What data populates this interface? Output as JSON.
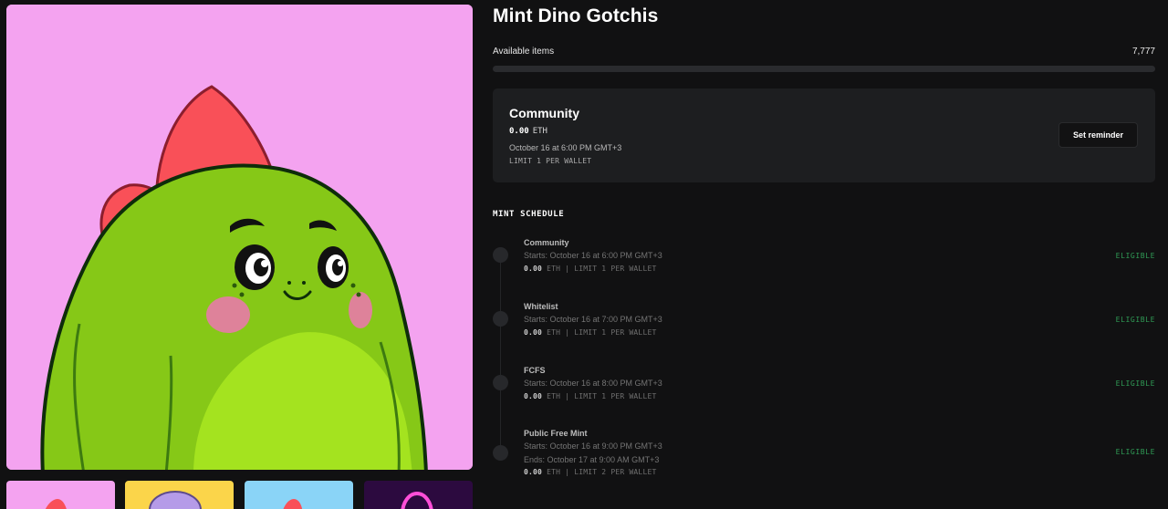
{
  "collection": {
    "title": "Mint Dino Gotchis",
    "available_label": "Available items",
    "available_count": "7,777",
    "progress_fraction": 0
  },
  "current_phase": {
    "name": "Community",
    "price": "0.00",
    "currency": "ETH",
    "date": "October 16 at 6:00 PM GMT+3",
    "limit": "LIMIT 1 PER WALLET",
    "reminder_button": "Set reminder"
  },
  "schedule": {
    "title": "MINT SCHEDULE",
    "phases": [
      {
        "name": "Community",
        "starts": "Starts: October 16 at 6:00 PM GMT+3",
        "price": "0.00",
        "meta": "ETH | LIMIT 1 PER WALLET",
        "status": "ELIGIBLE"
      },
      {
        "name": "Whitelist",
        "starts": "Starts: October 16 at 7:00 PM GMT+3",
        "price": "0.00",
        "meta": "ETH | LIMIT 1 PER WALLET",
        "status": "ELIGIBLE"
      },
      {
        "name": "FCFS",
        "starts": "Starts: October 16 at 8:00 PM GMT+3",
        "price": "0.00",
        "meta": "ETH | LIMIT 1 PER WALLET",
        "status": "ELIGIBLE"
      },
      {
        "name": "Public Free Mint",
        "starts": "Starts: October 16 at 9:00 PM GMT+3",
        "ends": "Ends: October 17 at 9:00 AM GMT+3",
        "price": "0.00",
        "meta": "ETH | LIMIT 2 PER WALLET",
        "status": "ELIGIBLE"
      }
    ]
  },
  "colors": {
    "background": "#111112",
    "card": "#1d1e20",
    "eligible": "#2f9a55",
    "hero_background": "#f4a3f0"
  },
  "images": {
    "hero": "green-dino-character",
    "thumbnails": [
      "pink-dino-thumbnail",
      "yellow-purple-thumbnail",
      "blue-dino-thumbnail",
      "purple-neon-thumbnail"
    ]
  }
}
